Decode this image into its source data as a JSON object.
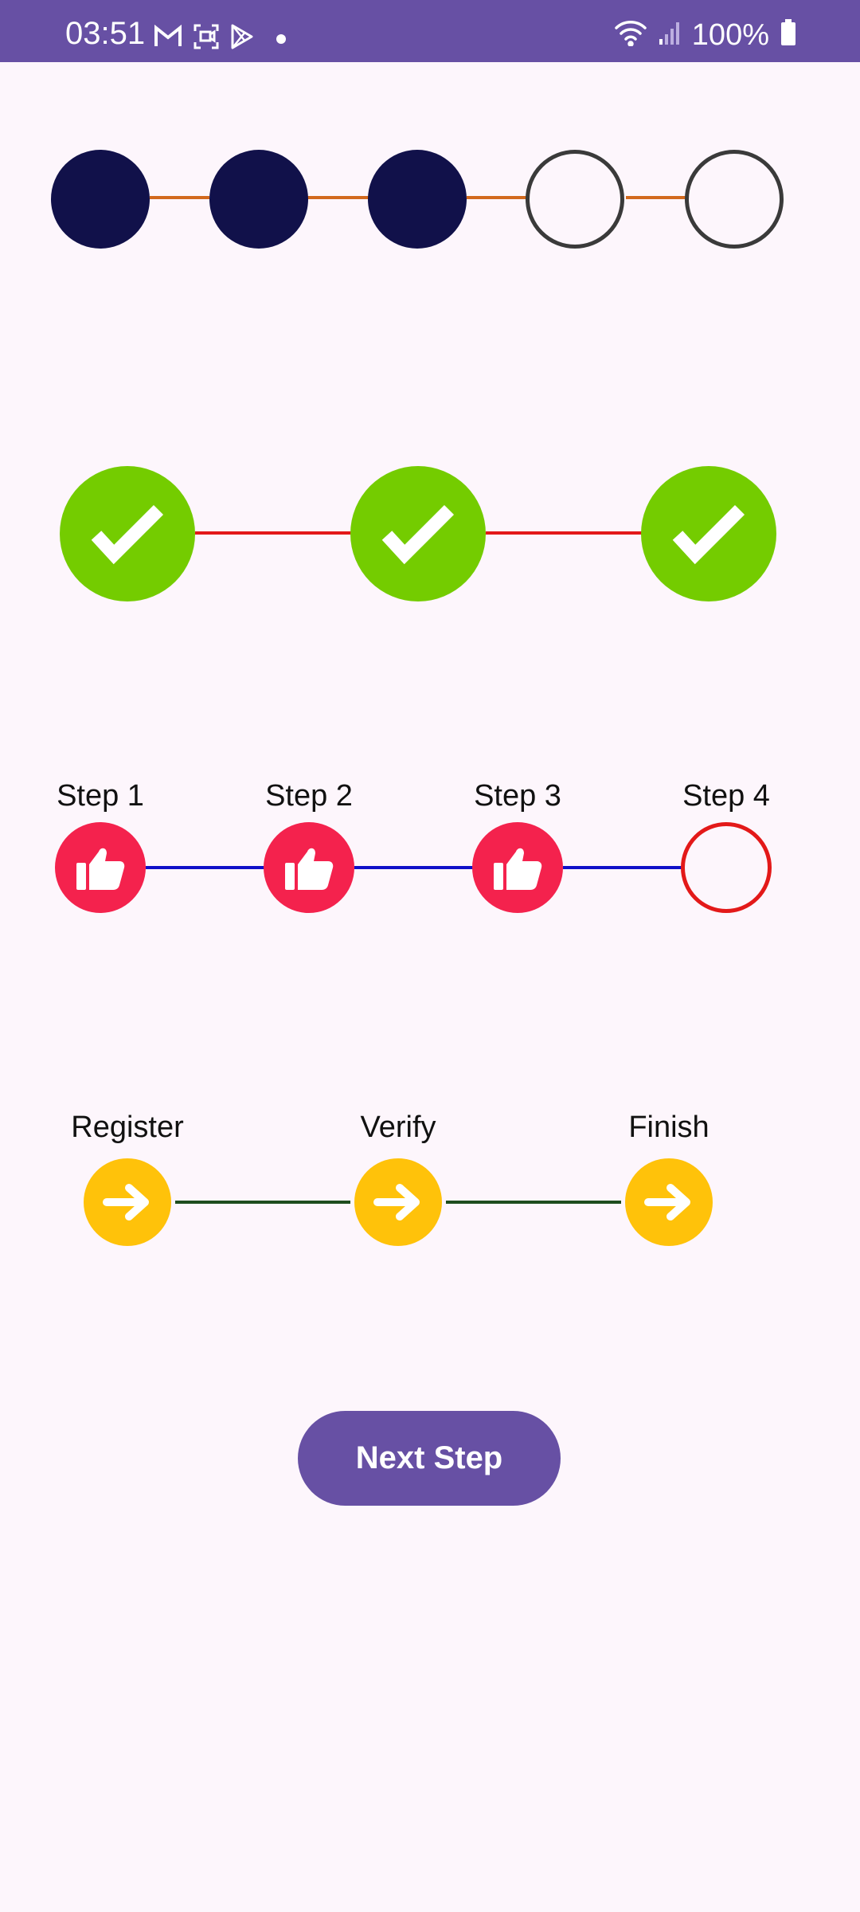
{
  "status_bar": {
    "time": "03:51",
    "battery": "100%",
    "icons_left": [
      "gmail-icon",
      "screenshot-icon",
      "play-store-icon",
      "notification-dot-icon"
    ],
    "icons_right": [
      "wifi-icon",
      "signal-icon",
      "battery-icon"
    ]
  },
  "stepper_dots": {
    "steps_total": 5,
    "steps_completed": 3,
    "filled_color": "#11114A",
    "empty_border_color": "#3A3A3A",
    "line_color": "#D2691E"
  },
  "stepper_checks": {
    "steps_total": 3,
    "steps_completed": 3,
    "circle_color": "#74CC00",
    "line_color": "#E31919",
    "icon": "check-icon"
  },
  "stepper_labeled": {
    "labels": [
      "Step 1",
      "Step 2",
      "Step 3",
      "Step 4"
    ],
    "steps_completed": 3,
    "done_color": "#F4224D",
    "todo_border_color": "#E31919",
    "line_color": "#1010C8",
    "icon": "thumbs-up-icon"
  },
  "stepper_flow": {
    "labels": [
      "Register",
      "Verify",
      "Finish"
    ],
    "circle_color": "#FFC20A",
    "line_color": "#1E4D1E",
    "icon": "arrow-right-icon"
  },
  "next_button": {
    "label": "Next Step",
    "color": "#6750A4"
  }
}
